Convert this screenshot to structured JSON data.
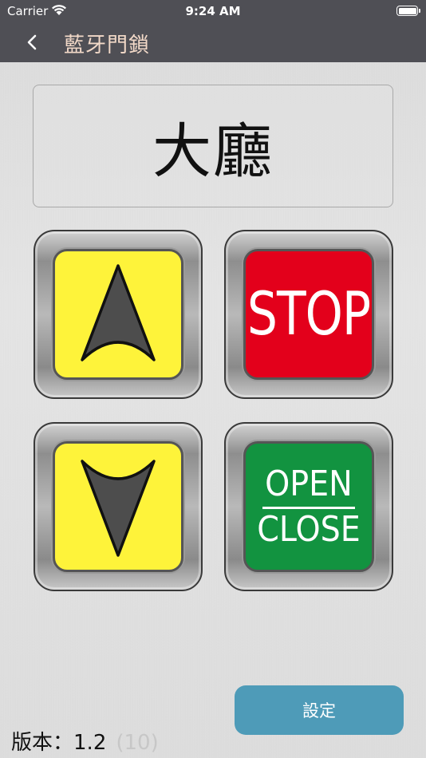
{
  "status_bar": {
    "carrier": "Carrier",
    "time": "9:24 AM"
  },
  "nav": {
    "title": "藍牙門鎖",
    "back_icon": "chevron-left-icon"
  },
  "display": {
    "room_name": "大廳"
  },
  "controls": {
    "up_icon": "arrow-up-icon",
    "down_icon": "arrow-down-icon",
    "stop_label": "STOP",
    "open_label": "OPEN",
    "close_label": "CLOSE"
  },
  "settings": {
    "label": "設定"
  },
  "version": {
    "label": "版本：",
    "number": "1.2",
    "build": "(10)"
  },
  "colors": {
    "bar": "#4f4f55",
    "title": "#f2d9c8",
    "yellow": "#fef33a",
    "stop_red": "#e3001b",
    "open_close_green": "#129340",
    "settings_button": "#4e9bb8"
  }
}
